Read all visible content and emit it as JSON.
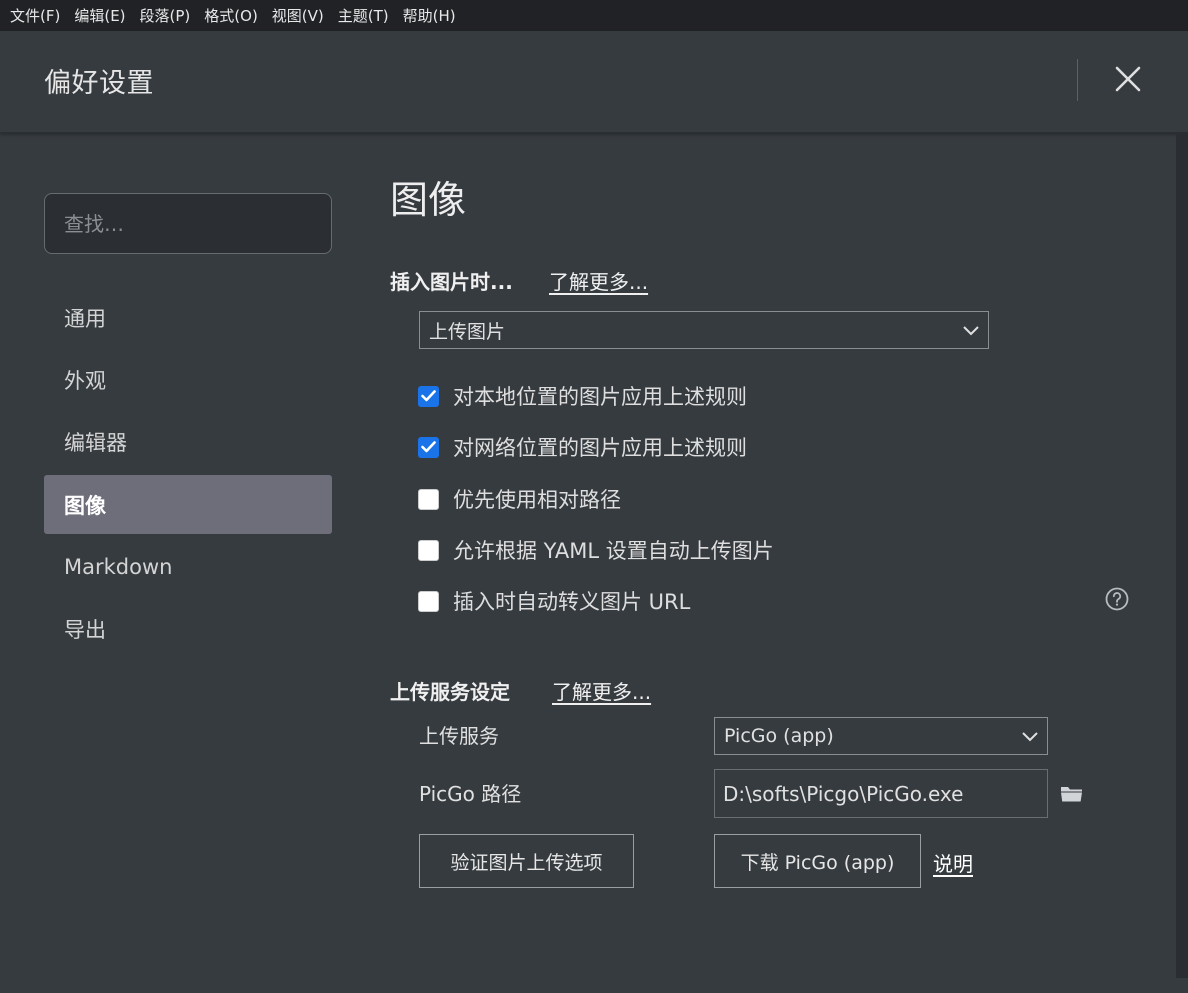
{
  "menubar": {
    "items": [
      "文件(F)",
      "编辑(E)",
      "段落(P)",
      "格式(O)",
      "视图(V)",
      "主题(T)",
      "帮助(H)"
    ]
  },
  "dialog": {
    "title": "偏好设置"
  },
  "sidebar": {
    "search_placeholder": "查找…",
    "items": [
      {
        "label": "通用",
        "active": false
      },
      {
        "label": "外观",
        "active": false
      },
      {
        "label": "编辑器",
        "active": false
      },
      {
        "label": "图像",
        "active": true
      },
      {
        "label": "Markdown",
        "active": false
      },
      {
        "label": "导出",
        "active": false
      }
    ]
  },
  "main": {
    "section_title": "图像",
    "insert_group": {
      "label": "插入图片时...",
      "learn_more": "了解更多...",
      "action_select": "上传图片",
      "options": [
        {
          "label": "对本地位置的图片应用上述规则",
          "checked": true
        },
        {
          "label": "对网络位置的图片应用上述规则",
          "checked": true
        },
        {
          "label": "优先使用相对路径",
          "checked": false
        },
        {
          "label": "允许根据 YAML 设置自动上传图片",
          "checked": false
        },
        {
          "label": "插入时自动转义图片 URL",
          "checked": false
        }
      ]
    },
    "upload_group": {
      "label": "上传服务设定",
      "learn_more": "了解更多...",
      "service_label": "上传服务",
      "service_value": "PicGo (app)",
      "path_label": "PicGo 路径",
      "path_value": "D:\\softs\\Picgo\\PicGo.exe",
      "verify_button": "验证图片上传选项",
      "download_button": "下载 PicGo (app)",
      "explain_link": "说明"
    }
  },
  "colors": {
    "background": "#363b40",
    "menubar": "#202225",
    "active_nav": "#6d6e7a",
    "checkbox_checked": "#1a73e8"
  },
  "icons": {
    "close": "close-icon",
    "chevron": "chevron-down-icon",
    "help": "help-circle-icon",
    "folder": "folder-icon",
    "check": "checkmark-icon"
  }
}
